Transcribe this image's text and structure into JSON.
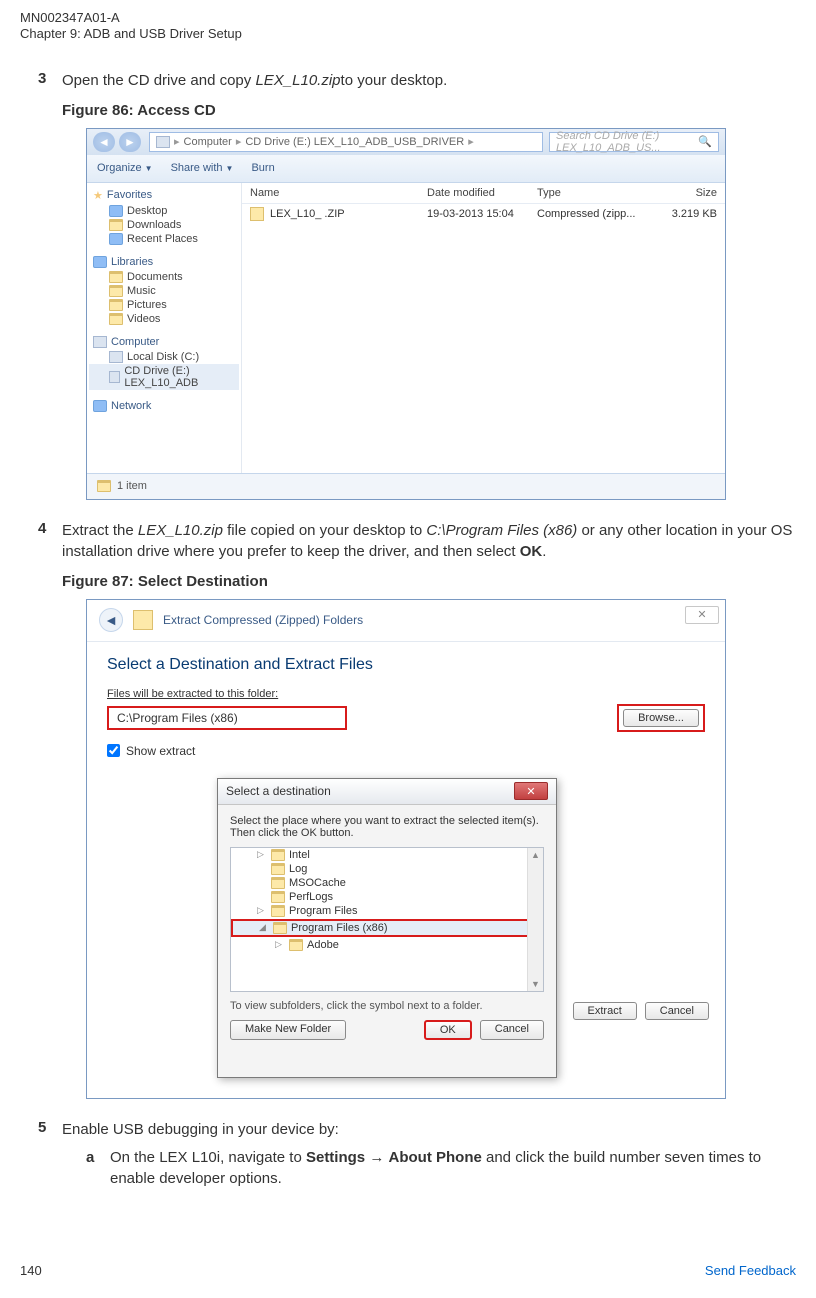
{
  "doc": {
    "id": "MN002347A01-A",
    "chapter": "Chapter 9:  ADB and USB Driver Setup",
    "page_number": "140",
    "feedback": "Send Feedback"
  },
  "steps": {
    "s3": {
      "num": "3",
      "text_pre": "Open the CD drive and copy ",
      "file": "LEX_L10.zip",
      "text_post": "to your desktop.",
      "figcap": "Figure 86: Access CD"
    },
    "s4": {
      "num": "4",
      "text_pre": "Extract the ",
      "file": "LEX_L10.zip",
      "text_mid1": " file copied on your desktop to ",
      "path": "C:\\Program Files (x86)",
      "text_mid2": " or any other location in your OS installation drive where you prefer to keep the driver, and then select ",
      "ok": "OK",
      "text_post": ".",
      "figcap": "Figure 87: Select Destination"
    },
    "s5": {
      "num": "5",
      "text": "Enable USB debugging in your device by:",
      "sa": {
        "num": "a",
        "pre": "On the LEX L10i, navigate to ",
        "settings": "Settings",
        "arrow": " → ",
        "about": "About Phone",
        "post": " and click the build number seven times to enable developer options."
      }
    }
  },
  "fig86": {
    "breadcrumb": {
      "root": "Computer",
      "p1": "CD Drive (E:) LEX_L10_ADB_USB_DRIVER"
    },
    "search_ph": "Search CD Drive (E:) LEX_L10_ADB_US...",
    "toolbar": {
      "organize": "Organize",
      "share": "Share with",
      "burn": "Burn"
    },
    "sidebar": {
      "favorites": "Favorites",
      "desktop": "Desktop",
      "downloads": "Downloads",
      "recent": "Recent Places",
      "libraries": "Libraries",
      "documents": "Documents",
      "music": "Music",
      "pictures": "Pictures",
      "videos": "Videos",
      "computer": "Computer",
      "localdisk": "Local Disk (C:)",
      "cddrive": "CD Drive (E:) LEX_L10_ADB",
      "network": "Network"
    },
    "cols": {
      "name": "Name",
      "date": "Date modified",
      "type": "Type",
      "size": "Size"
    },
    "row": {
      "name": "LEX_L10_ .ZIP",
      "date": "19-03-2013 15:04",
      "type": "Compressed (zipp...",
      "size": "3.219 KB"
    },
    "status": "1 item"
  },
  "fig87": {
    "title": "Extract Compressed (Zipped) Folders",
    "headline": "Select a Destination and Extract Files",
    "sublabel": "Files will be extracted to this folder:",
    "path": "C:\\Program Files (x86)",
    "browse": "Browse...",
    "showext": "Show extract",
    "extract": "Extract",
    "cancel": "Cancel",
    "inner": {
      "title": "Select a destination",
      "desc": "Select the place where you want to extract the selected item(s).  Then click the OK button.",
      "items": {
        "intel": "Intel",
        "log": "Log",
        "msocache": "MSOCache",
        "perflogs": "PerfLogs",
        "programfiles": "Program Files",
        "programfilesx86": "Program Files (x86)",
        "adobe": "Adobe"
      },
      "hint": "To view subfolders, click the symbol next to a folder.",
      "newfolder": "Make New Folder",
      "ok": "OK",
      "cancel": "Cancel"
    }
  }
}
